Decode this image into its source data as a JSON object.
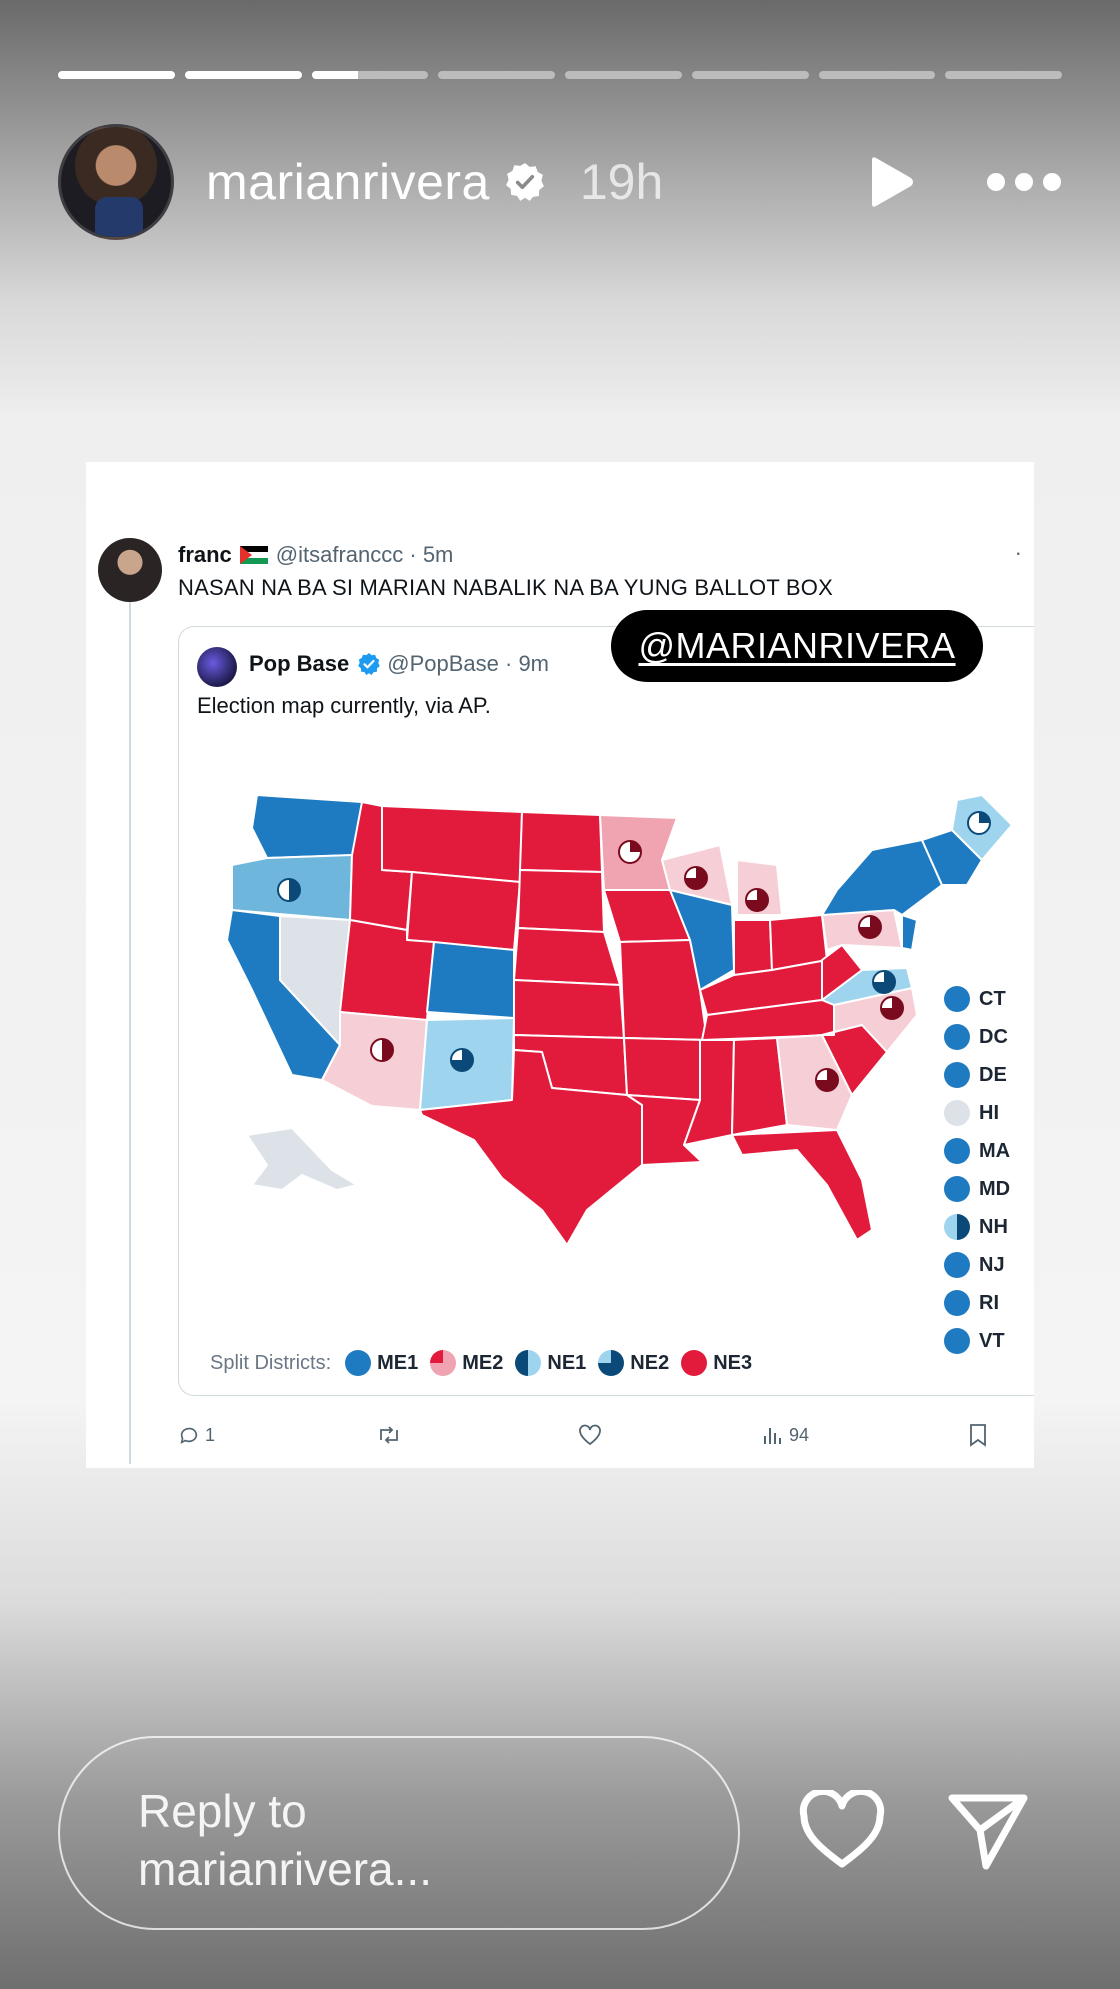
{
  "story": {
    "segments": [
      1,
      1,
      0.4,
      0,
      0,
      0,
      0,
      0
    ],
    "username": "marianrivera",
    "time": "19h",
    "mention": "@MARIANRIVERA",
    "reply_placeholder_line1": "Reply to",
    "reply_placeholder_line2": "marianrivera..."
  },
  "tweet": {
    "name": "franc",
    "handle_time": "@itsafranccc · 5m",
    "text": "NASAN NA BA SI MARIAN NABALIK NA BA YUNG BALLOT BOX",
    "quote": {
      "name": "Pop Base",
      "handle_time": "@PopBase · 9m",
      "text": "Election map currently, via AP."
    },
    "actions": {
      "replies": "1",
      "views": "94"
    }
  },
  "map": {
    "colors": {
      "dem": "#1f7bc1",
      "lean_dem": "#6fb6dd",
      "light_dem": "#9fd4ee",
      "rep": "#e21b3c",
      "lean_rep": "#f0a3b0",
      "light_rep": "#f6cfd6",
      "undecided": "#dde1e8"
    },
    "small_states": [
      {
        "label": "CT",
        "status": "dem"
      },
      {
        "label": "DC",
        "status": "dem"
      },
      {
        "label": "DE",
        "status": "dem"
      },
      {
        "label": "HI",
        "status": "undecided"
      },
      {
        "label": "MA",
        "status": "dem"
      },
      {
        "label": "MD",
        "status": "dem"
      },
      {
        "label": "NH",
        "status": "lean_dem"
      },
      {
        "label": "NJ",
        "status": "dem"
      },
      {
        "label": "RI",
        "status": "dem"
      },
      {
        "label": "VT",
        "status": "dem"
      }
    ],
    "split_label": "Split Districts:",
    "split_districts": [
      {
        "label": "ME1",
        "status": "dem"
      },
      {
        "label": "ME2",
        "status": "lean_rep"
      },
      {
        "label": "NE1",
        "status": "lean_dem"
      },
      {
        "label": "NE2",
        "status": "lean_dem"
      },
      {
        "label": "NE3",
        "status": "rep"
      }
    ]
  }
}
